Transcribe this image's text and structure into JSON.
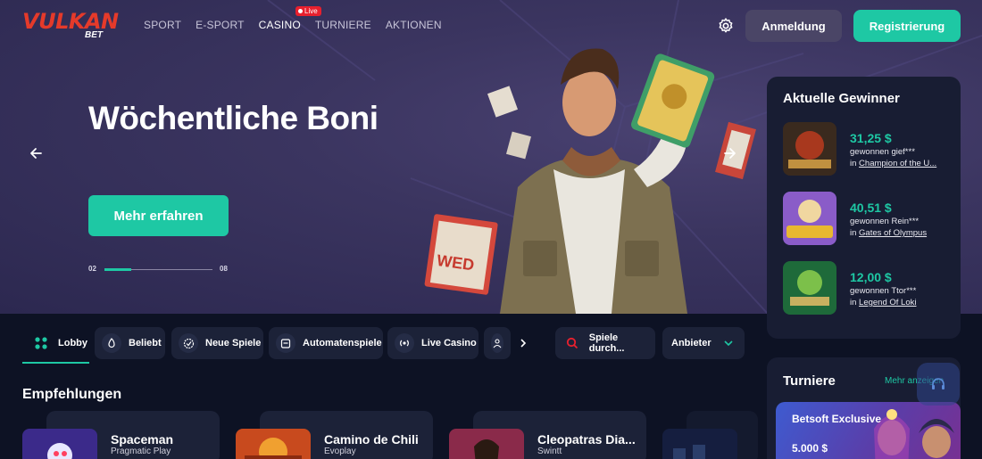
{
  "header": {
    "logo_text": "VULKAN",
    "logo_sub": "BET",
    "nav": [
      {
        "label": "SPORT"
      },
      {
        "label": "E-SPORT"
      },
      {
        "label": "CASINO"
      },
      {
        "label": "TURNIERE"
      },
      {
        "label": "AKTIONEN"
      }
    ],
    "live_badge": "Live",
    "settings_icon": "gear-icon",
    "login_label": "Anmeldung",
    "register_label": "Registrierung"
  },
  "hero": {
    "title": "Wöchentliche Boni",
    "button_label": "Mehr erfahren",
    "slide_current": "02",
    "slide_total": "08",
    "progress_fraction": 0.25,
    "graffiti_text": "WED"
  },
  "winners": {
    "title": "Aktuelle Gewinner",
    "items": [
      {
        "amount": "31,25 $",
        "who": "gewonnen gief***",
        "in": "in ",
        "game": "Champion of the U..."
      },
      {
        "amount": "40,51 $",
        "who": "gewonnen Rein***",
        "in": "in ",
        "game": "Gates of Olympus"
      },
      {
        "amount": "12,00 $",
        "who": "gewonnen Ttor***",
        "in": "in ",
        "game": "Legend Of Loki"
      }
    ]
  },
  "categories": [
    {
      "label": "Lobby",
      "icon": "grid-icon"
    },
    {
      "label": "Beliebt",
      "icon": "flame-icon"
    },
    {
      "label": "Neue Spiele",
      "icon": "badge-icon"
    },
    {
      "label": "Automatenspiele",
      "icon": "slot-machine-icon"
    },
    {
      "label": "Live Casino",
      "icon": "broadcast-icon"
    },
    {
      "label": "",
      "icon": "dealer-icon"
    }
  ],
  "search": {
    "label": "Spiele durch..."
  },
  "provider": {
    "label": "Anbieter"
  },
  "recommendations": {
    "title": "Empfehlungen",
    "games": [
      {
        "name": "Spaceman",
        "provider": "Pragmatic Play"
      },
      {
        "name": "Camino de Chili",
        "provider": "Evoplay"
      },
      {
        "name": "Cleopatras Dia...",
        "provider": "Swintt"
      }
    ]
  },
  "tournaments": {
    "title": "Turniere",
    "more_label": "Mehr anzeigen",
    "banner_name": "Betsoft Exclusive",
    "banner_amount": "5.000 $"
  },
  "colors": {
    "accent": "#1ec8a4",
    "brand_red": "#e53a2a",
    "background": "#0d1224"
  }
}
